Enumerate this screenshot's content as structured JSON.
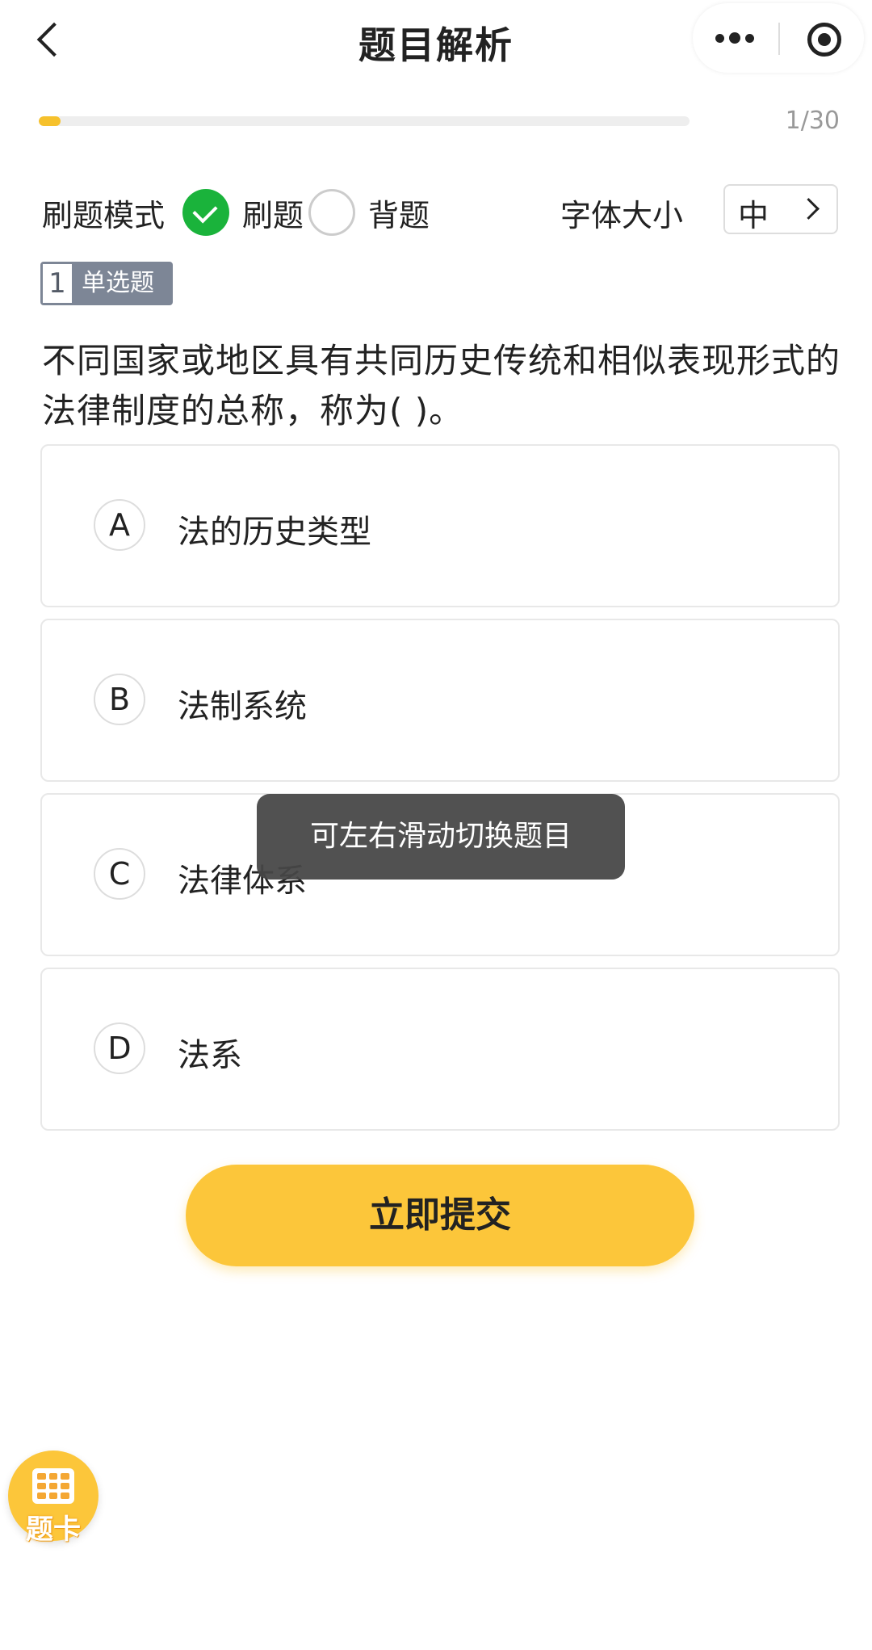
{
  "header": {
    "title": "题目解析",
    "back_icon": "chevron-left-icon",
    "more_icon": "more-dots-icon",
    "close_icon": "target-circle-icon"
  },
  "progress": {
    "current": 1,
    "total": 30,
    "label": "1/30",
    "fill_fraction": 0.033,
    "color": "#f6c12c"
  },
  "mode": {
    "label": "刷题模式",
    "options": [
      {
        "label": "刷题",
        "selected": true
      },
      {
        "label": "背题",
        "selected": false
      }
    ],
    "selected_color": "#1ab33b"
  },
  "font_size": {
    "label": "字体大小",
    "value": "中"
  },
  "question": {
    "number": "1",
    "type": "单选题",
    "text": "不同国家或地区具有共同历史传统和相似表现形式的法律制度的总称，称为( )。",
    "options": [
      {
        "letter": "A",
        "text": "法的历史类型"
      },
      {
        "letter": "B",
        "text": "法制系统"
      },
      {
        "letter": "C",
        "text": "法律体系"
      },
      {
        "letter": "D",
        "text": "法系"
      }
    ]
  },
  "submit": {
    "label": "立即提交",
    "color": "#fcc63a"
  },
  "toast": {
    "text": "可左右滑动切换题目"
  },
  "answer_card": {
    "label": "题卡",
    "icon": "grid-card-icon"
  }
}
